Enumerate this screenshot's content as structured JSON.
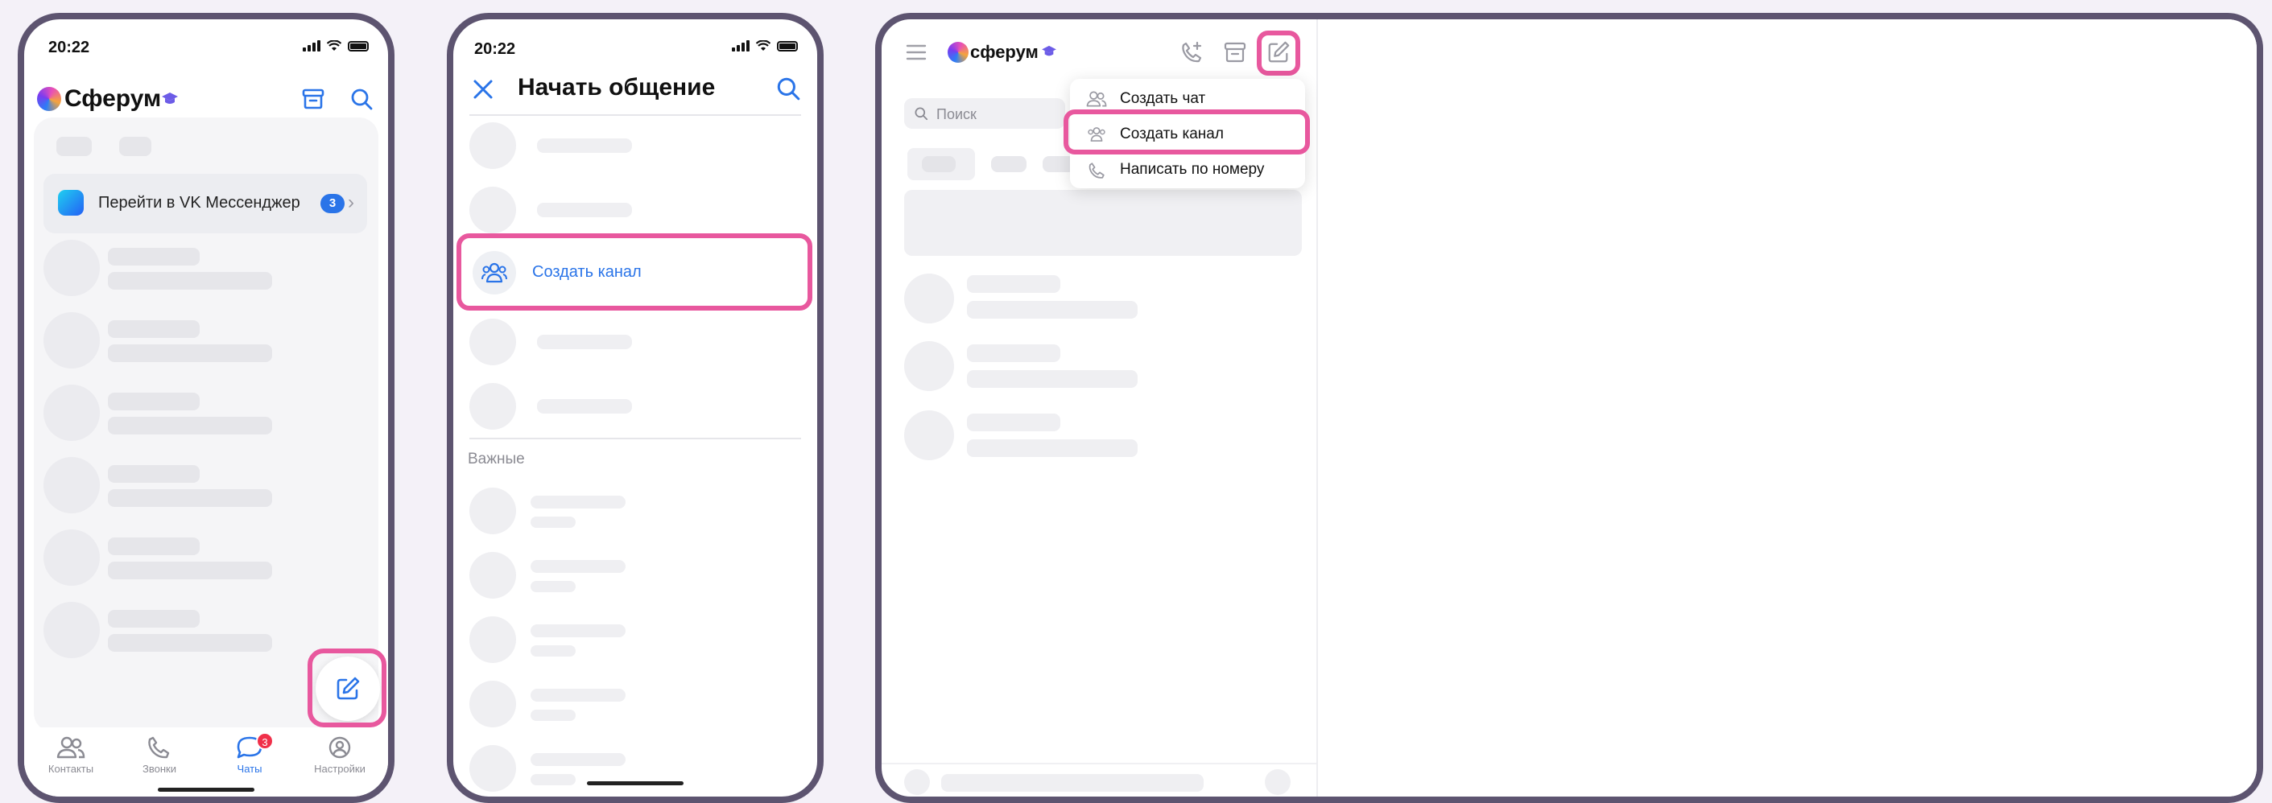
{
  "status": {
    "time": "20:22"
  },
  "brand": {
    "name": "Сферум"
  },
  "brand_lower": {
    "name": "сферум"
  },
  "phone1": {
    "vk_banner": {
      "text": "Перейти в VK Мессенджер",
      "count": "3"
    },
    "tabs": [
      {
        "label": "Контакты",
        "icon": "contacts-icon"
      },
      {
        "label": "Звонки",
        "icon": "phone-icon"
      },
      {
        "label": "Чаты",
        "icon": "chat-icon",
        "badge": "3",
        "active": true
      },
      {
        "label": "Настройки",
        "icon": "settings-icon"
      }
    ]
  },
  "phone2": {
    "title": "Начать общение",
    "create_channel": "Создать канал",
    "section": "Важные"
  },
  "desktop": {
    "search_placeholder": "Поиск",
    "menu": [
      {
        "label": "Создать чат",
        "icon": "users-icon"
      },
      {
        "label": "Создать канал",
        "icon": "channel-icon",
        "highlighted": true
      },
      {
        "label": "Написать по номеру",
        "icon": "phone-icon"
      }
    ]
  },
  "colors": {
    "accent": "#2a74e8",
    "highlight": "#e8589e",
    "frame": "#5d5470",
    "badge": "#f0304a"
  }
}
